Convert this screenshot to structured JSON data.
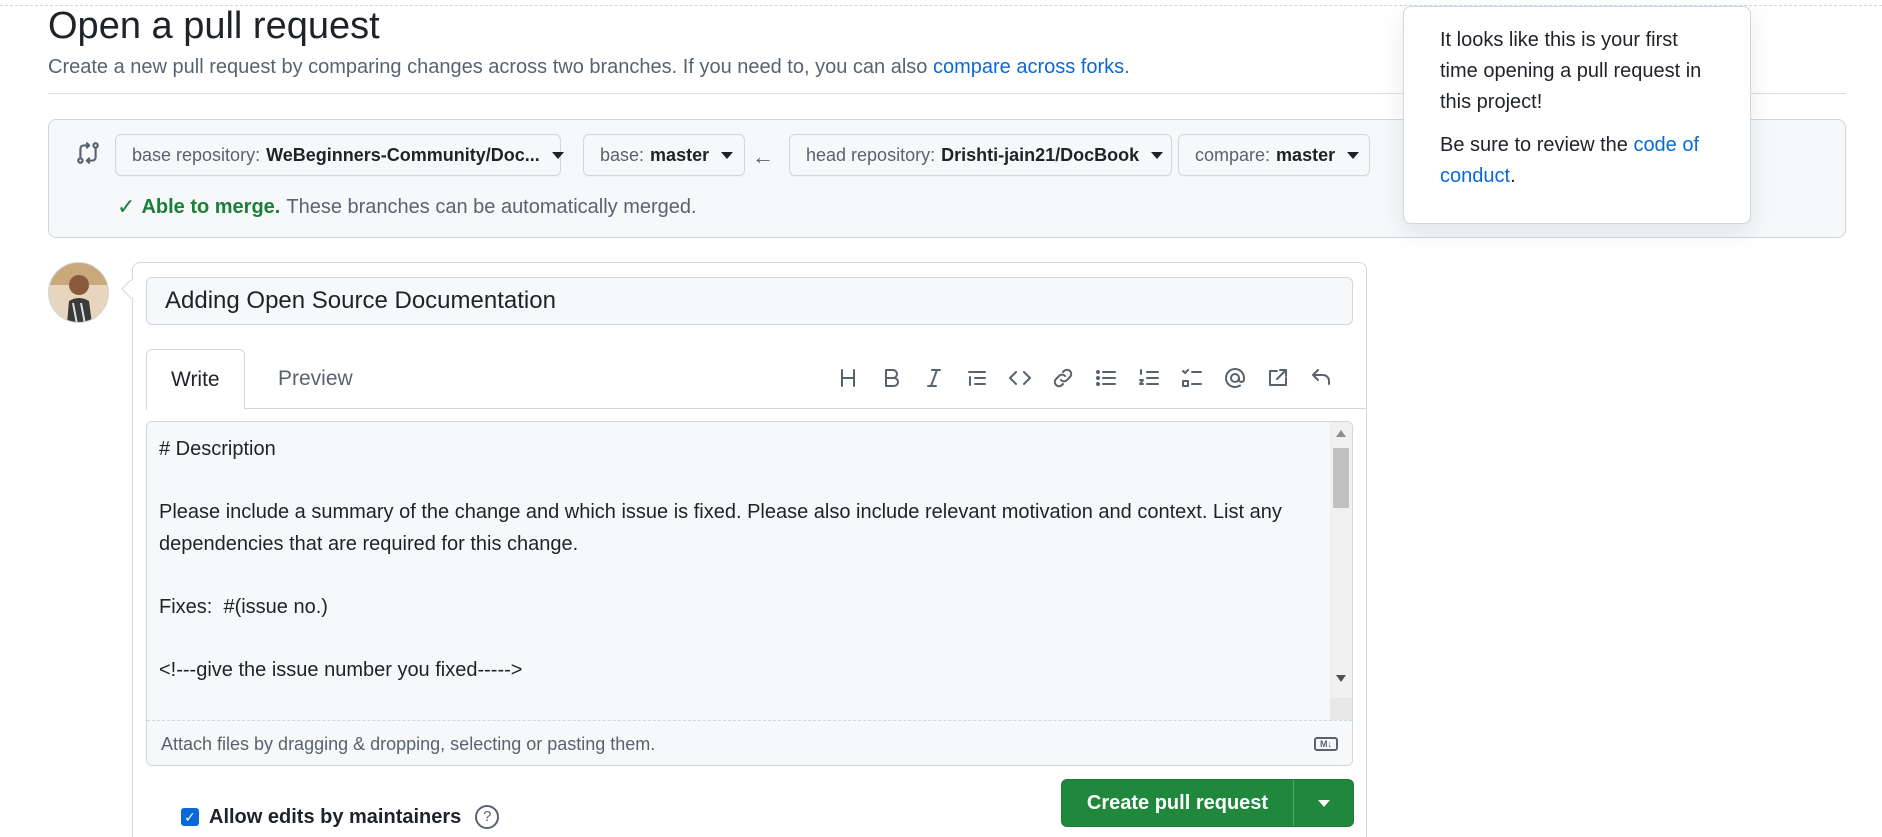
{
  "page": {
    "title": "Open a pull request",
    "subtitle_prefix": "Create a new pull request by comparing changes across two branches. If you need to, you can also ",
    "subtitle_link": "compare across forks",
    "subtitle_suffix": "."
  },
  "compare": {
    "base_repo_label": "base repository:",
    "base_repo_value": "WeBeginners-Community/Doc...",
    "base_label": "base:",
    "base_value": "master",
    "head_repo_label": "head repository:",
    "head_repo_value": "Drishti-jain21/DocBook",
    "compare_label": "compare:",
    "compare_value": "master",
    "merge_status": "Able to merge.",
    "merge_message": "These branches can be automatically merged."
  },
  "popover": {
    "line1": "It looks like this is your first time opening a pull request in this project!",
    "line2_prefix": "Be sure to review the ",
    "line2_link": "code of conduct",
    "line2_suffix": "."
  },
  "form": {
    "title_value": "Adding Open Source Documentation",
    "tabs": [
      {
        "label": "Write",
        "active": true
      },
      {
        "label": "Preview",
        "active": false
      }
    ],
    "toolbar_icons": [
      "heading-icon",
      "bold-icon",
      "italic-icon",
      "quote-icon",
      "code-icon",
      "link-icon",
      "unordered-list-icon",
      "ordered-list-icon",
      "task-list-icon",
      "mention-icon",
      "cross-reference-icon",
      "reply-icon"
    ],
    "body_text": "# Description\n\nPlease include a summary of the change and which issue is fixed. Please also include relevant motivation and context. List any dependencies that are required for this change.\n\nFixes:  #(issue no.)\n\n<!---give the issue number you fixed----->",
    "attach_text": "Attach files by dragging & dropping, selecting or pasting them.",
    "allow_edits_label": "Allow edits by maintainers",
    "allow_edits_checked": true,
    "create_button": "Create pull request"
  },
  "colors": {
    "accent": "#0969da",
    "success": "#1a7f37",
    "primary_button": "#1f883d"
  }
}
